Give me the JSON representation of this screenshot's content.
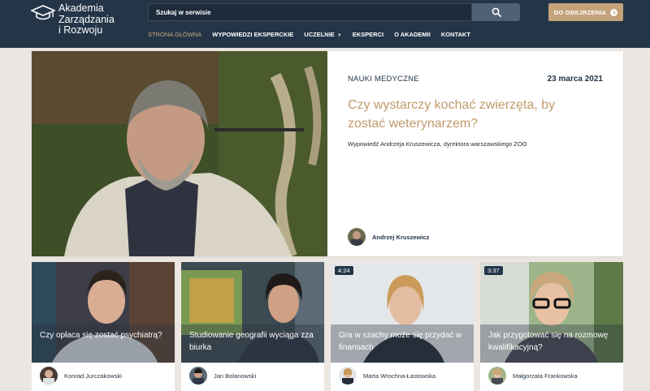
{
  "header": {
    "logo_lines": [
      "Akademia",
      "Zarządzania",
      "i Rozwoju"
    ],
    "search_placeholder": "Szukaj w serwisie",
    "observe_label": "DO OBEJRZENIA",
    "nav": [
      {
        "label": "STRONA GŁÓWNA",
        "active": true
      },
      {
        "label": "WYPOWIEDZI EKSPERCKIE"
      },
      {
        "label": "UCZELNIE",
        "has_dropdown": true
      },
      {
        "label": "EKSPERCI"
      },
      {
        "label": "O AKADEMII"
      },
      {
        "label": "KONTAKT"
      }
    ],
    "colors": {
      "bar": "#243548",
      "accent": "#c4a27a"
    }
  },
  "featured": {
    "category": "NAUKI MEDYCZNE",
    "date": "23 marca 2021",
    "title": "Czy wystarczy kochać zwierzęta, by zostać weterynarzem?",
    "excerpt": "Wypowiedź Andrzeja Kruszewicza, dyrektora warszawskiego ZOO",
    "author": "Andrzej Kruszewicz"
  },
  "cards": [
    {
      "title": "Czy opłaca się zostać psychiatrą?",
      "author": "Konrad Jurczakowski",
      "duration": ""
    },
    {
      "title": "Studiowanie geografii wyciąga zza biurka",
      "author": "Jan Bolanowski",
      "duration": ""
    },
    {
      "title": "Gra w szachy może się przydać w finansach",
      "author": "Marta Wrochna-Łastowska",
      "duration": "4:24"
    },
    {
      "title": "Jak przygotować się na rozmowę kwalifikacyjną?",
      "author": "Małgorzata Frankowska",
      "duration": "3:37"
    }
  ]
}
